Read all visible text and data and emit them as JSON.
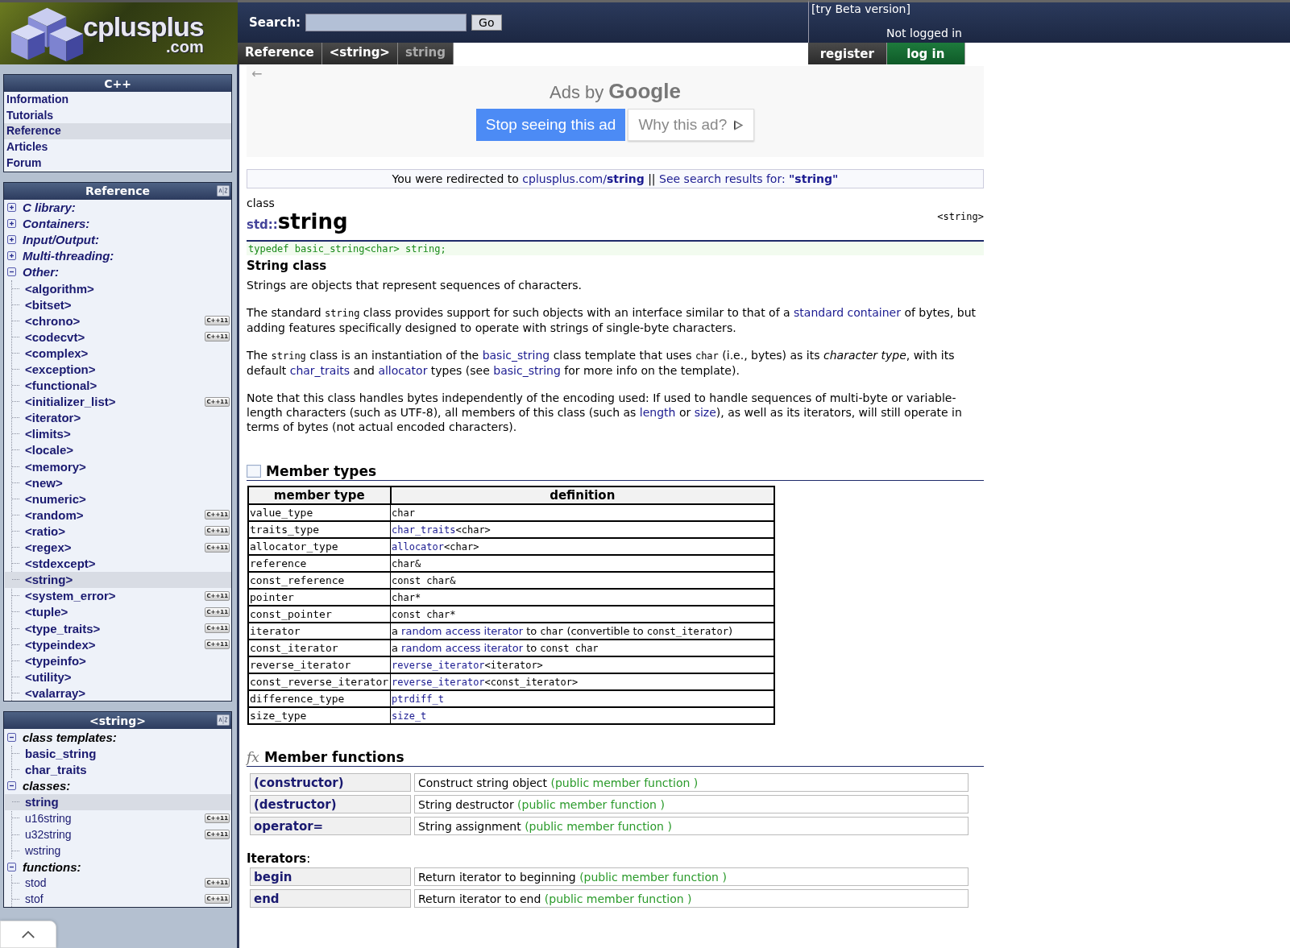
{
  "header": {
    "logo_text": "cplusplus",
    "logo_suffix": ".com",
    "search_label": "Search:",
    "search_button": "Go",
    "beta_link": "[try Beta version]",
    "login_status": "Not logged in"
  },
  "breadcrumbs": [
    {
      "label": "Reference",
      "selected": false
    },
    {
      "label": "<string>",
      "selected": false
    },
    {
      "label": "string",
      "selected": true
    }
  ],
  "account_buttons": [
    {
      "label": "register",
      "kind": "plain"
    },
    {
      "label": "log in",
      "kind": "primary"
    }
  ],
  "sidebar": [
    {
      "title": "C++",
      "sortable": false,
      "kind": "flat",
      "items": [
        {
          "label": "Information",
          "selected": false
        },
        {
          "label": "Tutorials",
          "selected": false
        },
        {
          "label": "Reference",
          "selected": true
        },
        {
          "label": "Articles",
          "selected": false
        },
        {
          "label": "Forum",
          "selected": false
        }
      ]
    },
    {
      "title": "Reference",
      "sortable": true,
      "kind": "tree",
      "groups": [
        {
          "label": "C library:",
          "expanded": false
        },
        {
          "label": "Containers:",
          "expanded": false
        },
        {
          "label": "Input/Output:",
          "expanded": false
        },
        {
          "label": "Multi-threading:",
          "expanded": false
        },
        {
          "label": "Other:",
          "expanded": true,
          "children": [
            {
              "label": "<algorithm>",
              "selected": false,
              "kind": "main"
            },
            {
              "label": "<bitset>",
              "selected": false,
              "kind": "main"
            },
            {
              "label": "<chrono>",
              "selected": false,
              "kind": "main",
              "badge": "C++11"
            },
            {
              "label": "<codecvt>",
              "selected": false,
              "kind": "main",
              "badge": "C++11"
            },
            {
              "label": "<complex>",
              "selected": false,
              "kind": "main"
            },
            {
              "label": "<exception>",
              "selected": false,
              "kind": "main"
            },
            {
              "label": "<functional>",
              "selected": false,
              "kind": "main"
            },
            {
              "label": "<initializer_list>",
              "selected": false,
              "kind": "main",
              "badge": "C++11"
            },
            {
              "label": "<iterator>",
              "selected": false,
              "kind": "main"
            },
            {
              "label": "<limits>",
              "selected": false,
              "kind": "main"
            },
            {
              "label": "<locale>",
              "selected": false,
              "kind": "main"
            },
            {
              "label": "<memory>",
              "selected": false,
              "kind": "main"
            },
            {
              "label": "<new>",
              "selected": false,
              "kind": "main"
            },
            {
              "label": "<numeric>",
              "selected": false,
              "kind": "main"
            },
            {
              "label": "<random>",
              "selected": false,
              "kind": "main",
              "badge": "C++11"
            },
            {
              "label": "<ratio>",
              "selected": false,
              "kind": "main",
              "badge": "C++11"
            },
            {
              "label": "<regex>",
              "selected": false,
              "kind": "main",
              "badge": "C++11"
            },
            {
              "label": "<stdexcept>",
              "selected": false,
              "kind": "main"
            },
            {
              "label": "<string>",
              "selected": true,
              "kind": "main"
            },
            {
              "label": "<system_error>",
              "selected": false,
              "kind": "main",
              "badge": "C++11"
            },
            {
              "label": "<tuple>",
              "selected": false,
              "kind": "main",
              "badge": "C++11"
            },
            {
              "label": "<type_traits>",
              "selected": false,
              "kind": "main",
              "badge": "C++11"
            },
            {
              "label": "<typeindex>",
              "selected": false,
              "kind": "main",
              "badge": "C++11"
            },
            {
              "label": "<typeinfo>",
              "selected": false,
              "kind": "main"
            },
            {
              "label": "<utility>",
              "selected": false,
              "kind": "main"
            },
            {
              "label": "<valarray>",
              "selected": false,
              "kind": "main"
            }
          ]
        }
      ]
    },
    {
      "title": "<string>",
      "sortable": true,
      "kind": "tree",
      "groups": [
        {
          "label": "class templates:",
          "expanded": true,
          "children": [
            {
              "label": "basic_string",
              "selected": false,
              "kind": "main"
            },
            {
              "label": "char_traits",
              "selected": false,
              "kind": "main"
            }
          ]
        },
        {
          "label": "classes:",
          "expanded": true,
          "children": [
            {
              "label": "string",
              "selected": true,
              "kind": "main"
            },
            {
              "label": "u16string",
              "selected": false,
              "kind": "minor",
              "badge": "C++11"
            },
            {
              "label": "u32string",
              "selected": false,
              "kind": "minor",
              "badge": "C++11"
            },
            {
              "label": "wstring",
              "selected": false,
              "kind": "minor"
            }
          ]
        },
        {
          "label": "functions:",
          "expanded": true,
          "children": [
            {
              "label": "stod",
              "selected": false,
              "kind": "minor",
              "badge": "C++11"
            },
            {
              "label": "stof",
              "selected": false,
              "kind": "minor",
              "badge": "C++11"
            }
          ]
        }
      ]
    }
  ],
  "ad": {
    "back": "←",
    "label": "Ads by",
    "brand": "Google",
    "stop_button": "Stop seeing this ad",
    "why_button": "Why this ad?"
  },
  "redirect": [
    {
      "kind": "text",
      "text": "You were redirected to "
    },
    {
      "kind": "link",
      "text": "cplusplus.com/**string**"
    },
    {
      "kind": "text",
      "text": " || "
    },
    {
      "kind": "link",
      "text": "See search results for: **\"string\"**"
    }
  ],
  "article": {
    "kicker": "class",
    "namespace": "std::",
    "title": "string",
    "header_name": "<string>",
    "declaration": "typedef basic_string<char> string;",
    "subtitle": "String class",
    "paragraphs": [
      [
        {
          "kind": "text",
          "text": "Strings are objects that represent sequences of characters."
        }
      ],
      [
        {
          "kind": "text",
          "text": "The standard "
        },
        {
          "kind": "code",
          "text": "string"
        },
        {
          "kind": "text",
          "text": " class provides support for such objects with an interface similar to that of a "
        },
        {
          "kind": "link",
          "text": "standard container"
        },
        {
          "kind": "text",
          "text": " of bytes, but adding features specifically designed to operate with strings of single-byte characters."
        }
      ],
      [
        {
          "kind": "text",
          "text": "The "
        },
        {
          "kind": "code",
          "text": "string"
        },
        {
          "kind": "text",
          "text": " class is an instantiation of the "
        },
        {
          "kind": "link",
          "text": "basic_string"
        },
        {
          "kind": "text",
          "text": " class template that uses "
        },
        {
          "kind": "code",
          "text": "char"
        },
        {
          "kind": "text",
          "text": " (i.e., bytes) as its "
        },
        {
          "kind": "em",
          "text": "character type"
        },
        {
          "kind": "text",
          "text": ", with its default "
        },
        {
          "kind": "link",
          "text": "char_traits"
        },
        {
          "kind": "text",
          "text": " and "
        },
        {
          "kind": "link",
          "text": "allocator"
        },
        {
          "kind": "text",
          "text": " types (see "
        },
        {
          "kind": "link",
          "text": "basic_string"
        },
        {
          "kind": "text",
          "text": " for more info on the template)."
        }
      ],
      [
        {
          "kind": "text",
          "text": "Note that this class handles bytes independently of the encoding used: If used to handle sequences of multi-byte or variable-length characters (such as UTF-8), all members of this class (such as "
        },
        {
          "kind": "link",
          "text": "length"
        },
        {
          "kind": "text",
          "text": " or "
        },
        {
          "kind": "link",
          "text": "size"
        },
        {
          "kind": "text",
          "text": "), as well as its iterators, will still operate in terms of bytes (not actual encoded characters)."
        }
      ]
    ]
  },
  "member_types": {
    "title": "Member types",
    "columns": [
      "member type",
      "definition"
    ],
    "rows": [
      {
        "name": "value_type",
        "definition": [
          {
            "kind": "code",
            "text": "char"
          }
        ]
      },
      {
        "name": "traits_type",
        "definition": [
          {
            "kind": "codelink",
            "text": "char_traits"
          },
          {
            "kind": "code",
            "text": "<char>"
          }
        ]
      },
      {
        "name": "allocator_type",
        "definition": [
          {
            "kind": "codelink",
            "text": "allocator"
          },
          {
            "kind": "code",
            "text": "<char>"
          }
        ]
      },
      {
        "name": "reference",
        "definition": [
          {
            "kind": "code",
            "text": "char&"
          }
        ]
      },
      {
        "name": "const_reference",
        "definition": [
          {
            "kind": "code",
            "text": "const char&"
          }
        ]
      },
      {
        "name": "pointer",
        "definition": [
          {
            "kind": "code",
            "text": "char*"
          }
        ]
      },
      {
        "name": "const_pointer",
        "definition": [
          {
            "kind": "code",
            "text": "const char*"
          }
        ]
      },
      {
        "name": "iterator",
        "definition": [
          {
            "kind": "text",
            "text": "a "
          },
          {
            "kind": "link",
            "text": "random access iterator"
          },
          {
            "kind": "text",
            "text": " to "
          },
          {
            "kind": "code",
            "text": "char"
          },
          {
            "kind": "text",
            "text": " (convertible to "
          },
          {
            "kind": "code",
            "text": "const_iterator"
          },
          {
            "kind": "text",
            "text": ")"
          }
        ]
      },
      {
        "name": "const_iterator",
        "definition": [
          {
            "kind": "text",
            "text": "a "
          },
          {
            "kind": "link",
            "text": "random access iterator"
          },
          {
            "kind": "text",
            "text": " to "
          },
          {
            "kind": "code",
            "text": "const char"
          }
        ]
      },
      {
        "name": "reverse_iterator",
        "definition": [
          {
            "kind": "codelink",
            "text": "reverse_iterator"
          },
          {
            "kind": "code",
            "text": "<iterator>"
          }
        ]
      },
      {
        "name": "const_reverse_iterator",
        "definition": [
          {
            "kind": "codelink",
            "text": "reverse_iterator"
          },
          {
            "kind": "code",
            "text": "<const_iterator>"
          }
        ]
      },
      {
        "name": "difference_type",
        "definition": [
          {
            "kind": "codelink",
            "text": "ptrdiff_t"
          }
        ]
      },
      {
        "name": "size_type",
        "definition": [
          {
            "kind": "codelink",
            "text": "size_t"
          }
        ]
      }
    ]
  },
  "member_functions": {
    "icon_text": "fx",
    "title": "Member functions",
    "groups": [
      {
        "rows": [
          {
            "name": "(constructor)",
            "description": "Construct string object",
            "note": "(public member function )"
          },
          {
            "name": "(destructor)",
            "description": "String destructor",
            "note": "(public member function )"
          },
          {
            "name": "operator=",
            "description": "String assignment",
            "note": "(public member function )"
          }
        ]
      },
      {
        "heading": "**Iterators**:",
        "rows": [
          {
            "name": "begin",
            "description": "Return iterator to beginning",
            "note": "(public member function )"
          },
          {
            "name": "end",
            "description": "Return iterator to end",
            "note": "(public member function )"
          }
        ]
      }
    ]
  }
}
